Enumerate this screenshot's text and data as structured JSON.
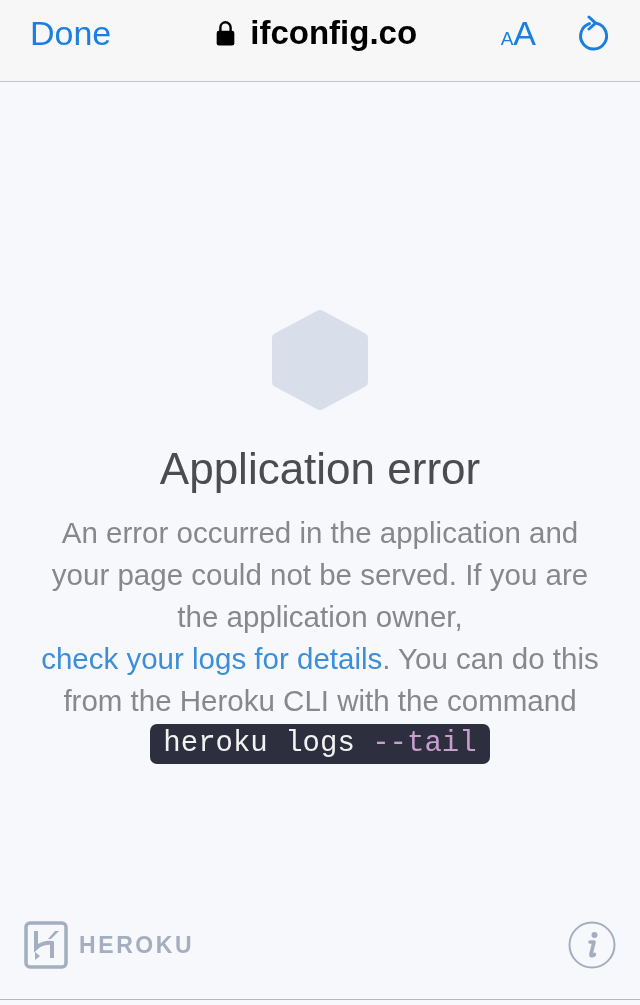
{
  "browser_bar": {
    "done_button": "Done",
    "secure": true,
    "url": "ifconfig.co",
    "text_size_button": "AA"
  },
  "error": {
    "title": "Application error",
    "message": {
      "before": "An error occurred in the application and your page could not be served. If you are the application owner, ",
      "link": "check your logs for details",
      "after": ". You can do this from the Heroku CLI with the command"
    },
    "command": [
      {
        "kind": "command",
        "text": "heroku logs"
      },
      {
        "kind": "flag",
        "text": "--tail"
      }
    ]
  },
  "footer": {
    "brand": "HEROKU"
  }
}
